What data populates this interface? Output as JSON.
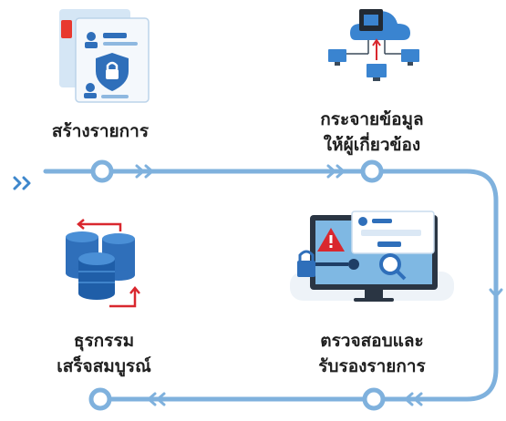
{
  "steps": [
    {
      "id": "create",
      "lines": [
        "สร้างรายการ"
      ],
      "icon": "document-lock-icon"
    },
    {
      "id": "distribute",
      "lines": [
        "กระจายข้อมูล",
        "ให้ผู้เกี่ยวข้อง"
      ],
      "icon": "cloud-network-icon"
    },
    {
      "id": "verify",
      "lines": [
        "ตรวจสอบและ",
        "รับรองรายการ"
      ],
      "icon": "monitor-security-icon"
    },
    {
      "id": "complete",
      "lines": [
        "ธุรกรรม",
        "เสร็จสมบูรณ์"
      ],
      "icon": "database-cycle-icon"
    }
  ],
  "colors": {
    "flow": "#7fb1dd",
    "accent_blue": "#2f6fba",
    "alert_red": "#d9272e"
  }
}
